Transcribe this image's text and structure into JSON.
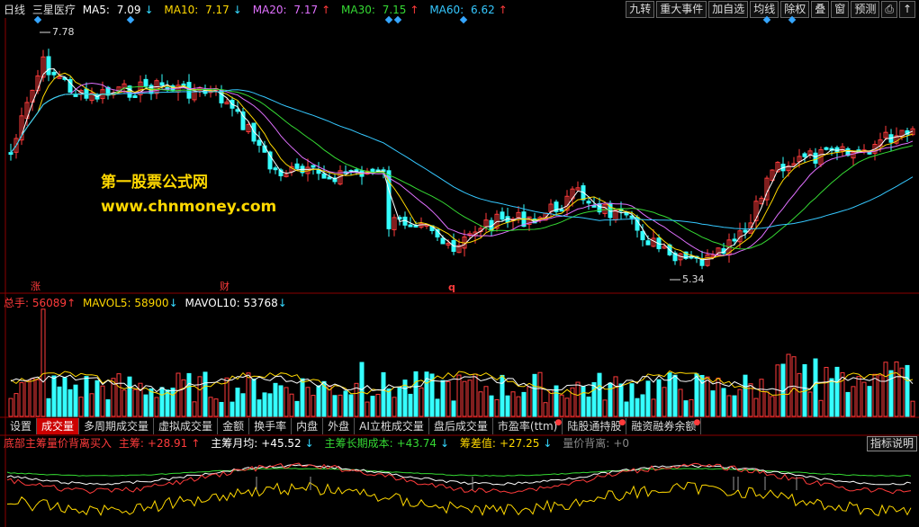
{
  "header": {
    "period": "日线",
    "stock_name": "三星医疗",
    "ma5": {
      "label": "MA5:",
      "value": "7.09",
      "arrow": "↓",
      "color": "#ffffff"
    },
    "ma10": {
      "label": "MA10:",
      "value": "7.17",
      "arrow": "↓",
      "color": "#ffd800"
    },
    "ma20": {
      "label": "MA20:",
      "value": "7.17",
      "arrow": "↑",
      "color": "#e070ff"
    },
    "ma30": {
      "label": "MA30:",
      "value": "7.15",
      "arrow": "↑",
      "color": "#35d933"
    },
    "ma60": {
      "label": "MA60:",
      "value": "6.62",
      "arrow": "↑",
      "color": "#35c8ff"
    }
  },
  "toolbar": [
    "九转",
    "重大事件",
    "加自选",
    "均线",
    "除权",
    "叠",
    "窗",
    "预测",
    "⎙",
    "↑"
  ],
  "price_chart": {
    "high_label": "7.78",
    "low_label": "5.34",
    "markers": [
      "涨",
      "财",
      "q"
    ]
  },
  "watermark": {
    "line1": "第一股票公式网",
    "line2": "www.chnmoney.com"
  },
  "volume_header": {
    "total_label": "总手:",
    "total_value": "56089",
    "total_arrow": "↑",
    "mavol5_label": "MAVOL5:",
    "mavol5_value": "58900",
    "mavol5_arrow": "↓",
    "mavol10_label": "MAVOL10:",
    "mavol10_value": "53768",
    "mavol10_arrow": "↓"
  },
  "tabs": [
    {
      "label": "设置",
      "active": false,
      "dot": false
    },
    {
      "label": "成交量",
      "active": true,
      "dot": false
    },
    {
      "label": "多周期成交量",
      "active": false,
      "dot": false
    },
    {
      "label": "虚拟成交量",
      "active": false,
      "dot": false
    },
    {
      "label": "金额",
      "active": false,
      "dot": false
    },
    {
      "label": "换手率",
      "active": false,
      "dot": false
    },
    {
      "label": "内盘",
      "active": false,
      "dot": false
    },
    {
      "label": "外盘",
      "active": false,
      "dot": false
    },
    {
      "label": "AI立桩成交量",
      "active": false,
      "dot": false
    },
    {
      "label": "盘后成交量",
      "active": false,
      "dot": false
    },
    {
      "label": "市盈率(ttm)",
      "active": false,
      "dot": true
    },
    {
      "label": "陆股通持股",
      "active": false,
      "dot": true
    },
    {
      "label": "融资融券余额",
      "active": false,
      "dot": true
    }
  ],
  "indicator": {
    "name": "底部主筹量价背离买入",
    "zhuchou_label": "主筹:",
    "zhuchou_value": "+28.91",
    "zhuchou_arrow": "↑",
    "yuejun_label": "主筹月均:",
    "yuejun_value": "+45.52",
    "yuejun_arrow": "↓",
    "changqi_label": "主筹长期成本:",
    "changqi_value": "+43.74",
    "changqi_arrow": "↓",
    "chouchai_label": "筹差值:",
    "chouchai_value": "+27.25",
    "chouchai_arrow": "↓",
    "beili_label": "量价背离:",
    "beili_value": "+0",
    "help": "指标说明"
  },
  "colors": {
    "up": "#ff3b3b",
    "down": "#35ffff",
    "ma5": "#ffffff",
    "ma10": "#ffd800",
    "ma20": "#e070ff",
    "ma30": "#35d933",
    "ma60": "#35c8ff"
  }
}
